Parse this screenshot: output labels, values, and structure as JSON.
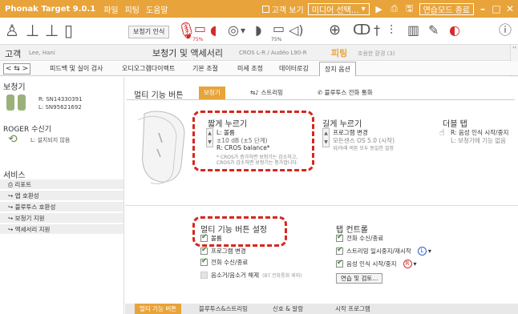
{
  "titlebar": {
    "app_title": "Phonak Target 9.0.1",
    "menu": [
      "파일",
      "피팅",
      "도움말"
    ],
    "client_view": "고객 보기",
    "media_select": "미디어 선택...",
    "practice_mode_end": "연습모드 종료",
    "minimize": "–",
    "restore": "□",
    "close": "✕",
    "bg_color": "#e8a33a"
  },
  "toolbar": {
    "hi_connect": "보청기 인식",
    "battery_left": "75%",
    "battery_right": "75%",
    "accent_red": "#d42b2b"
  },
  "header": {
    "client_label": "고객",
    "client_name": "Lee, Hani",
    "section_title": "보청기 및 액세서리",
    "section_sub": "CROS L-R / Audéo L90-R",
    "fitting_label": "피팅",
    "fitting_sub": "조용한 환경 (3)"
  },
  "main_tabs": {
    "nav_arrows": "< ⇆ >",
    "items": [
      "피드백 및 실이 검사",
      "오디오그램다이렉트",
      "기본 조절",
      "미세 조정",
      "데이터로깅",
      "장치 옵션"
    ],
    "active": "장치 옵션"
  },
  "sidebar": {
    "hi_title": "보청기",
    "sn_right": "R: SN14330391",
    "sn_left": "L: SN95621692",
    "roger_title": "ROGER 수신기",
    "roger_status": "L: 설치되지 않음",
    "services_title": "서비스",
    "services": [
      "리포트",
      "앱 호환성",
      "블루투스 호환성",
      "보청기 지원",
      "액세서리 지원"
    ]
  },
  "main": {
    "multi_function_label": "멀티 기능 버튼",
    "sub_tabs": [
      "보청기",
      "스트리밍",
      "블루투스 전화 통화"
    ],
    "short_press": {
      "title": "짧게 누르기",
      "line1": "L: 볼륨",
      "line2": "±10 dB (±5 단계)",
      "line3": "R: CROS balance*",
      "note1": "* CROS가 증가하면 보청기는 감소하고,",
      "note2": "CROS가 감소하면 보청기는 증가합니다."
    },
    "long_press": {
      "title": "길게 누르기",
      "line1": "프로그램 변경",
      "line2": "모든센스 OS 5.0 (시작)",
      "note": "위/아래 버튼 모두 동일한 설정"
    },
    "double_tap": {
      "title": "더블 탭",
      "line1": "R: 음성 인식 시작/중지",
      "line2": "L: 보청기에 기능 없음"
    },
    "settings": {
      "title": "멀티 기능 버튼 설정",
      "items": [
        {
          "label": "볼륨",
          "checked": true
        },
        {
          "label": "프로그램 변경",
          "checked": true
        },
        {
          "label": "전화 수신/종료",
          "checked": true
        },
        {
          "label": "음소거/음소거 해제",
          "checked": false
        }
      ],
      "mute_note": "(BT 전화통화 제외)"
    },
    "tap_control": {
      "title": "탭 컨트롤",
      "items": [
        {
          "label": "전화 수신/종료",
          "checked": true,
          "side": ""
        },
        {
          "label": "스트리밍 일시중지/재시작",
          "checked": true,
          "side": "L"
        },
        {
          "label": "음성 인식 시작/중지",
          "checked": true,
          "side": "R"
        }
      ],
      "practice_button": "연습 및 검토...",
      "left_color": "#2f5fc8",
      "right_color": "#d42b2b"
    },
    "bottom_tabs": [
      "멀티 기능 버튼",
      "블루투스&스트리밍",
      "신호 & 알람",
      "시작 프로그램"
    ],
    "bottom_active": "멀티 기능 버튼",
    "highlight_color": "#d8261d"
  }
}
